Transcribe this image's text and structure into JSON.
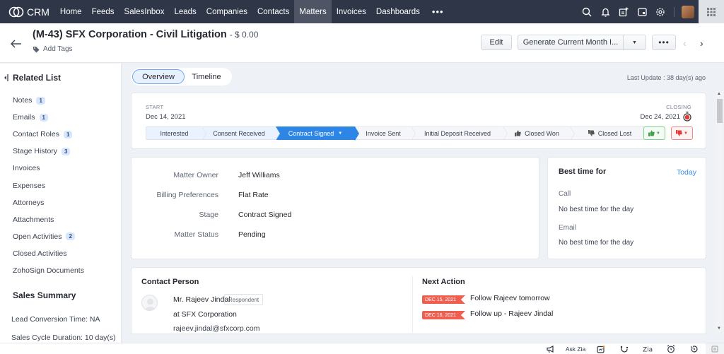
{
  "app": {
    "name": "CRM"
  },
  "nav": {
    "items": [
      {
        "label": "Home",
        "active": false
      },
      {
        "label": "Feeds",
        "active": false
      },
      {
        "label": "SalesInbox",
        "active": false
      },
      {
        "label": "Leads",
        "active": false
      },
      {
        "label": "Companies",
        "active": false
      },
      {
        "label": "Contacts",
        "active": false
      },
      {
        "label": "Matters",
        "active": true
      },
      {
        "label": "Invoices",
        "active": false
      },
      {
        "label": "Dashboards",
        "active": false
      }
    ],
    "more_label": "•••",
    "icons": [
      "search-icon",
      "bell-icon",
      "new-note-icon",
      "calendar-icon",
      "gear-icon"
    ]
  },
  "record": {
    "title": "(M-43) SFX Corporation - Civil Litigation",
    "amount": "- $ 0.00",
    "add_tags_label": "Add Tags"
  },
  "toolbar": {
    "edit_label": "Edit",
    "generate_label": "Generate Current Month I...",
    "more_label": "•••",
    "prev_label": "‹",
    "next_label": "›"
  },
  "sidebar": {
    "related_list_title": "Related List",
    "items": [
      {
        "label": "Notes",
        "count": "1"
      },
      {
        "label": "Emails",
        "count": "1"
      },
      {
        "label": "Contact Roles",
        "count": "1"
      },
      {
        "label": "Stage History",
        "count": "3"
      },
      {
        "label": "Invoices",
        "count": null
      },
      {
        "label": "Expenses",
        "count": null
      },
      {
        "label": "Attorneys",
        "count": null
      },
      {
        "label": "Attachments",
        "count": null
      },
      {
        "label": "Open Activities",
        "count": "2"
      },
      {
        "label": "Closed Activities",
        "count": null
      },
      {
        "label": "ZohoSign Documents",
        "count": null
      }
    ],
    "sales_summary_title": "Sales Summary",
    "lead_conversion": "Lead Conversion Time: NA",
    "sales_cycle": "Sales Cycle Duration: 10 day(s)"
  },
  "tabs": [
    {
      "label": "Overview",
      "active": true
    },
    {
      "label": "Timeline",
      "active": false
    }
  ],
  "last_update": "Last Update : 38 day(s) ago",
  "stage_card": {
    "start_label": "START",
    "start_date": "Dec 14, 2021",
    "closing_label": "CLOSING",
    "closing_date": "Dec 24, 2021",
    "stages": [
      {
        "label": "Interested",
        "state": "done"
      },
      {
        "label": "Consent Received",
        "state": "done"
      },
      {
        "label": "Contract Signed",
        "state": "current"
      },
      {
        "label": "Invoice Sent",
        "state": "after"
      },
      {
        "label": "Initial Deposit Received",
        "state": "after"
      },
      {
        "label": "Closed Won",
        "state": "after",
        "icon": "thumbs-up-icon"
      },
      {
        "label": "Closed Lost",
        "state": "after",
        "icon": "thumbs-down-icon"
      }
    ]
  },
  "details": {
    "fields": [
      {
        "label": "Matter Owner",
        "value": "Jeff Williams"
      },
      {
        "label": "Billing Preferences",
        "value": "Flat Rate"
      },
      {
        "label": "Stage",
        "value": "Contract Signed"
      },
      {
        "label": "Matter Status",
        "value": "Pending"
      }
    ]
  },
  "best_time": {
    "title": "Best time for",
    "period": "Today",
    "call_label": "Call",
    "call_value": "No best time for the day",
    "email_label": "Email",
    "email_value": "No best time for the day"
  },
  "contact_person": {
    "title": "Contact Person",
    "name": "Mr. Rajeev Jindal",
    "role": "Respondent",
    "company": "at SFX Corporation",
    "email": "rajeev.jindal@sfxcorp.com"
  },
  "next_action": {
    "title": "Next Action",
    "items": [
      {
        "date": "DEC 15, 2021",
        "text": "Follow Rajeev tomorrow"
      },
      {
        "date": "DEC 16, 2021",
        "text": "Follow up - Rajeev Jindal"
      }
    ]
  },
  "bottom_bar": {
    "ask_zia_label": "Ask Zia"
  },
  "colors": {
    "nav_bg": "#2f3647",
    "accent": "#2d86e5",
    "won": "#4caf50",
    "lost": "#e53935",
    "date_tag": "#ef5f50"
  }
}
